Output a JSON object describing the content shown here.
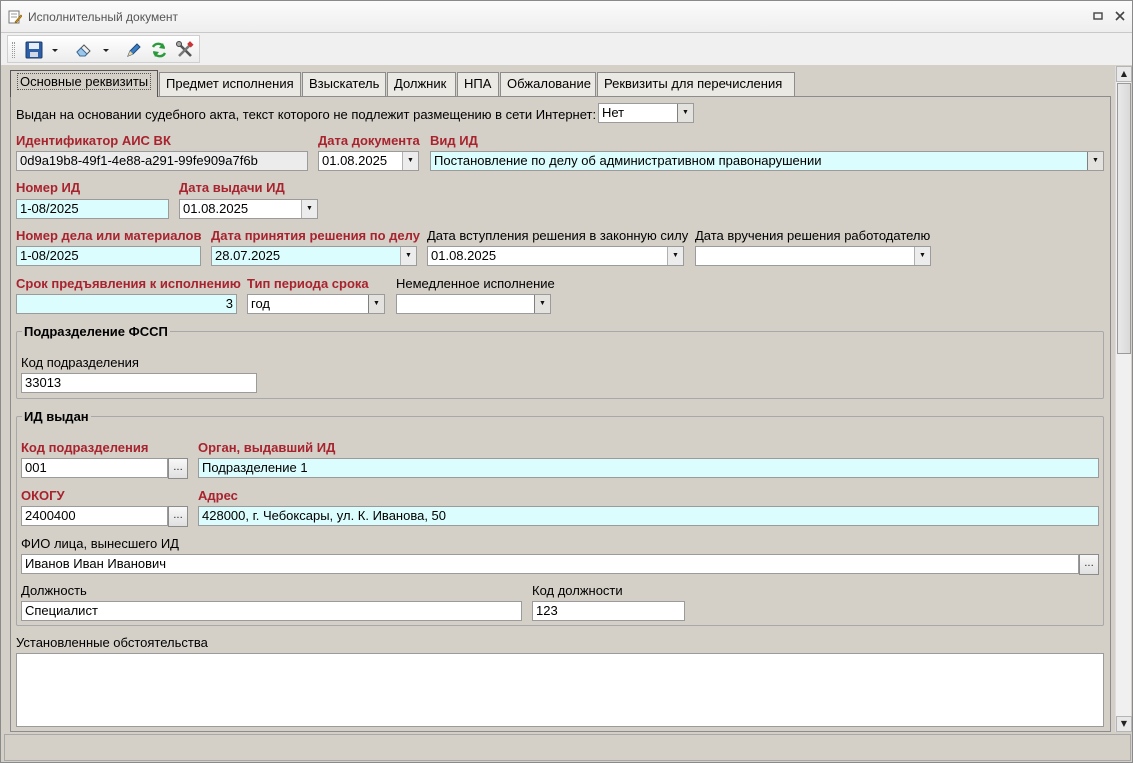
{
  "window": {
    "title": "Исполнительный документ",
    "restore_glyph": "▫",
    "close_glyph": "✕"
  },
  "toolbar": {
    "buttons": [
      "save-icon",
      "dropdown-arrow",
      "eraser-icon",
      "dropdown-arrow",
      "pen-icon",
      "refresh-icon",
      "tools-icon"
    ]
  },
  "tabs": [
    {
      "label": "Основные реквизиты",
      "active": true
    },
    {
      "label": "Предмет исполнения"
    },
    {
      "label": "Взыскатель"
    },
    {
      "label": "Должник"
    },
    {
      "label": "НПА"
    },
    {
      "label": "Обжалование"
    },
    {
      "label": "Реквизиты для перечисления"
    }
  ],
  "form": {
    "internet_question": "Выдан на основании судебного акта, текст которого не подлежит размещению в сети Интернет:",
    "internet_value": "Нет",
    "ais_id_label": "Идентификатор АИС ВК",
    "ais_id_value": "0d9a19b8-49f1-4e88-a291-99fe909a7f6b",
    "doc_date_label": "Дата документа",
    "doc_date_value": "01.08.2025",
    "doc_kind_label": "Вид ИД",
    "doc_kind_value": "Постановление по делу об административном правонарушении",
    "id_number_label": "Номер ИД",
    "id_number_value": "1-08/2025",
    "issue_date_label": "Дата выдачи ИД",
    "issue_date_value": "01.08.2025",
    "case_number_label": "Номер дела или материалов",
    "case_number_value": "1-08/2025",
    "decision_date_label": "Дата принятия решения по делу",
    "decision_date_value": "28.07.2025",
    "effective_date_label": "Дата вступления решения в законную силу",
    "effective_date_value": "01.08.2025",
    "employer_date_label": "Дата вручения решения работодателю",
    "employer_date_value": "",
    "term_label": "Срок предъявления к исполнению",
    "term_value": "3",
    "period_type_label": "Тип периода срока",
    "period_type_value": "год",
    "immediate_label": "Немедленное исполнение",
    "immediate_value": ""
  },
  "fssp": {
    "title": "Подразделение ФССП",
    "code_label": "Код подразделения",
    "code_value": "33013"
  },
  "issued": {
    "title": "ИД выдан",
    "code_label": "Код подразделения",
    "code_value": "001",
    "organ_label": "Орган, выдавший ИД",
    "organ_value": "Подразделение 1",
    "okogu_label": "ОКОГУ",
    "okogu_value": "2400400",
    "address_label": "Адрес",
    "address_value": "428000, г. Чебоксары, ул. К. Иванова, 50",
    "person_label": "ФИО лица, вынесшего ИД",
    "person_value": "Иванов Иван Иванович",
    "position_label": "Должность",
    "position_value": "Специалист",
    "position_code_label": "Код должности",
    "position_code_value": "123"
  },
  "circumstances": {
    "label": "Установленные обстоятельства",
    "value": ""
  },
  "glyphs": {
    "combo": "▼",
    "ellipsis": "...",
    "scroll_up": "▲",
    "scroll_down": "▼"
  }
}
